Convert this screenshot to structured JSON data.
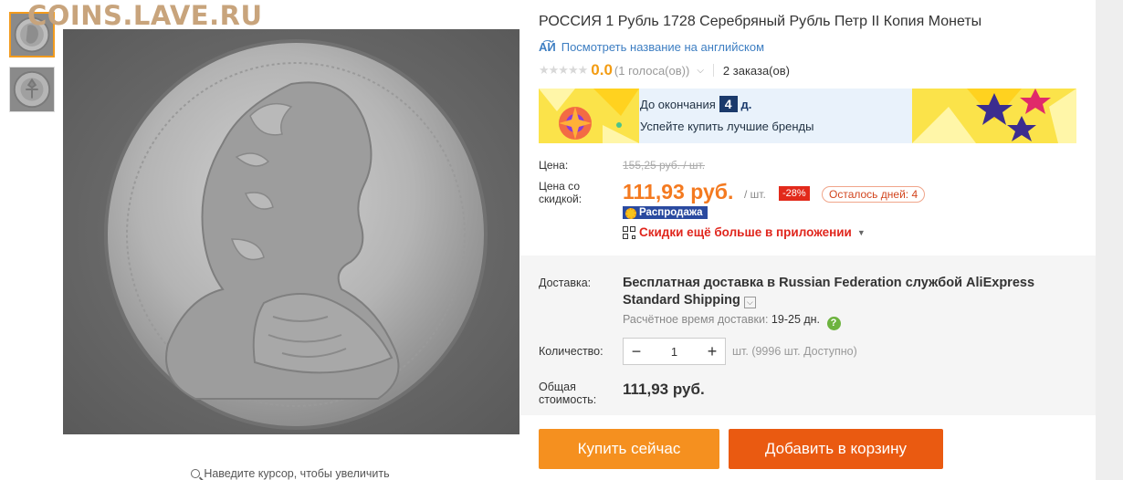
{
  "watermark": "COINS.LAVE.RU",
  "gallery": {
    "zoom_hint": "Наведите курсор, чтобы увеличить"
  },
  "product": {
    "title": "РОССИЯ 1 Рубль 1728 Серебряный Рубль Петр II Копия Монеты",
    "translate_link": "Посмотреть название на английском",
    "rating_value": "0.0",
    "votes": "(1 голоса(ов))",
    "orders": "2 заказа(ов)"
  },
  "promo": {
    "countdown_prefix": "До окончания",
    "days_number": "4",
    "days_unit": "д.",
    "slogan": "Успейте купить лучшие бренды"
  },
  "price": {
    "label": "Цена:",
    "old_price": "155,25 руб. / шт.",
    "discount_label": "Цена со скидкой:",
    "new_price": "111,93 руб.",
    "unit": "/ шт.",
    "discount_percent": "-28%",
    "days_left": "Осталось дней: 4",
    "sale_badge": "Распродажа",
    "app_discount": "Скидки ещё больше в приложении"
  },
  "delivery": {
    "label": "Доставка:",
    "text_bold_1": "Бесплатная доставка",
    "text_mid": " в Russian Federation службой AliExpress Standard Shipping",
    "time_label": "Расчётное время доставки:",
    "time_value": "19-25 дн."
  },
  "quantity": {
    "label": "Количество:",
    "value": "1",
    "available": "шт. (9996 шт. Доступно)"
  },
  "total": {
    "label": "Общая стоимость:",
    "value": "111,93 руб."
  },
  "actions": {
    "buy_now": "Купить сейчас",
    "add_to_cart": "Добавить в корзину"
  },
  "colors": {
    "accent_orange": "#f47a20",
    "buy_button": "#f5901f",
    "cart_button": "#ea5a11",
    "discount_red": "#e22a1b",
    "link_blue": "#3d7ec2"
  }
}
